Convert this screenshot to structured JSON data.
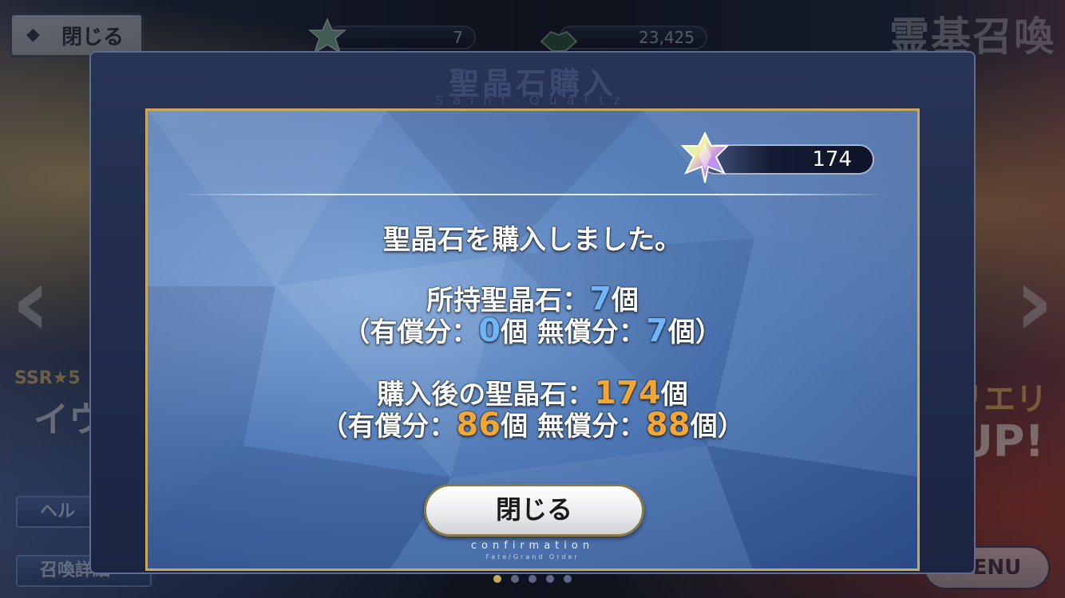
{
  "header": {
    "back_label": "閉じる",
    "quartz_count": "7",
    "friend_points": "23,425",
    "screen_title": "霊基召喚"
  },
  "background": {
    "left_banner_text": "SSR★5",
    "left_banner_text2": "イウ",
    "right_banner_text": "リエリ",
    "right_banner_text2": "UP!",
    "help_label": "ヘル",
    "summon_detail_label": "召喚詳細",
    "menu_label": "MENU"
  },
  "dialog": {
    "title": "聖晶石購入",
    "subtitle": "Saint Quartz",
    "quartz_balance": "174",
    "message": "聖晶石を購入しました。",
    "owned_label": "所持聖晶石：",
    "owned_value": "7",
    "owned_unit": "個",
    "owned_breakdown_open": "（有償分：",
    "owned_paid": "0",
    "owned_mid": "個 無償分：",
    "owned_free": "7",
    "owned_breakdown_close": "個）",
    "after_label": "購入後の聖晶石：",
    "after_value": "174",
    "after_unit": "個",
    "after_breakdown_open": "（有償分：",
    "after_paid": "86",
    "after_mid": "個 無償分：",
    "after_free": "88",
    "after_breakdown_close": "個）",
    "close_label": "閉じる",
    "caption": "confirmation",
    "caption_sub": "Fate/Grand Order"
  },
  "colors": {
    "accent_blue": "#6fb4ff",
    "accent_gold": "#f3a632",
    "frame_gold": "#c9a85a"
  },
  "icons": {
    "quartz": "saint-quartz-icon",
    "friend": "friend-point-icon",
    "back": "chevron-left-icon"
  }
}
